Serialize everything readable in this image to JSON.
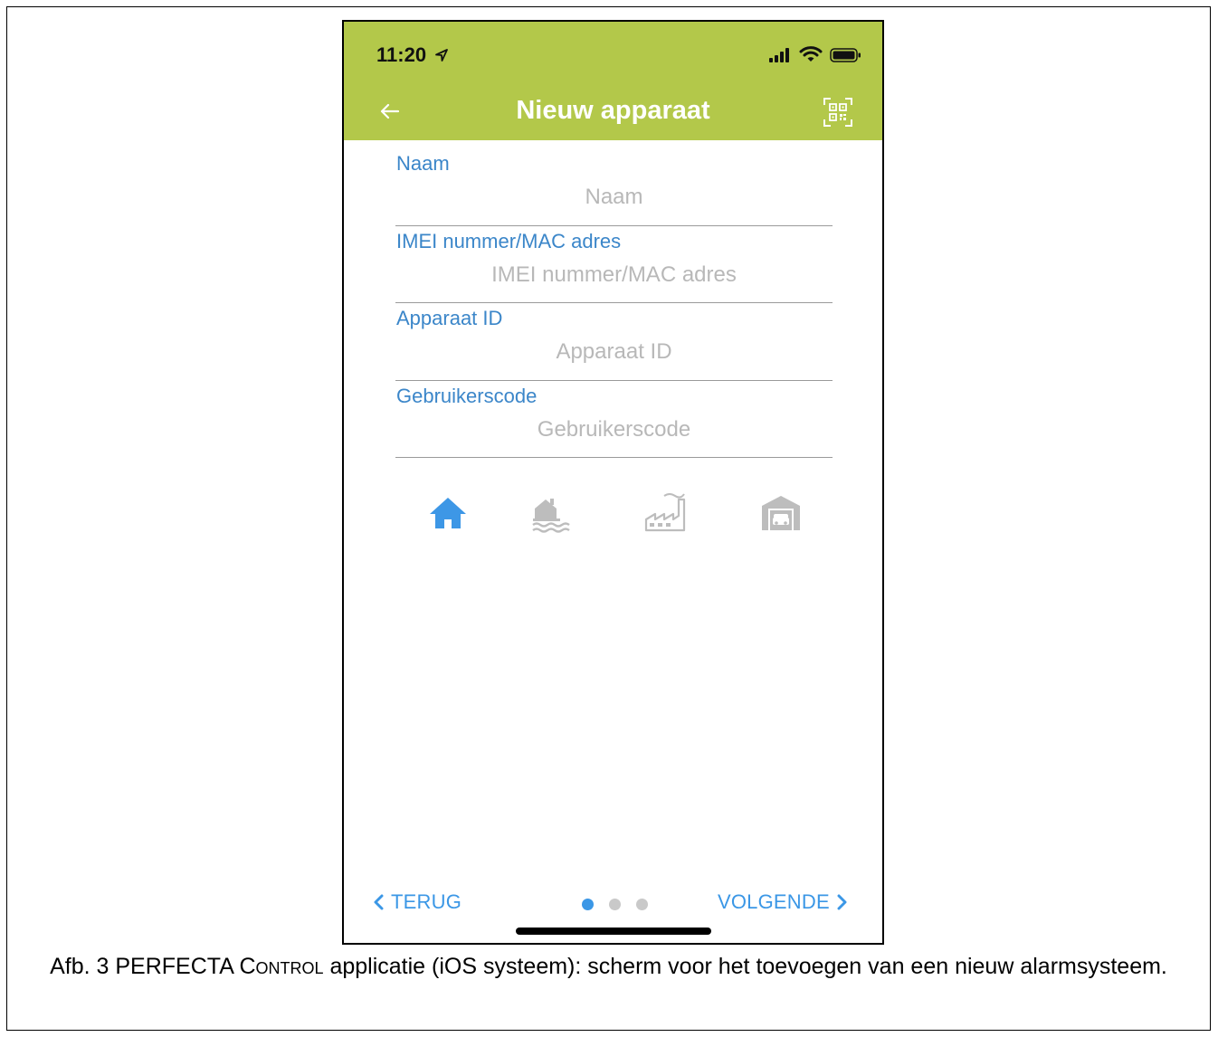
{
  "status_bar": {
    "time": "11:20"
  },
  "app_bar": {
    "title": "Nieuw apparaat"
  },
  "form": {
    "fields": [
      {
        "label": "Naam",
        "placeholder": "Naam",
        "value": ""
      },
      {
        "label": "IMEI nummer/MAC adres",
        "placeholder": "IMEI nummer/MAC adres",
        "value": ""
      },
      {
        "label": "Apparaat ID",
        "placeholder": "Apparaat ID",
        "value": ""
      },
      {
        "label": "Gebruikerscode",
        "placeholder": "Gebruikerscode",
        "value": ""
      }
    ]
  },
  "building_types": [
    {
      "icon": "house-icon",
      "selected": true
    },
    {
      "icon": "house-by-water-icon",
      "selected": false
    },
    {
      "icon": "factory-icon",
      "selected": false
    },
    {
      "icon": "garage-icon",
      "selected": false
    }
  ],
  "footer": {
    "back_label": "TERUG",
    "next_label": "VOLGENDE",
    "page_indicator": {
      "total": 3,
      "current": 1
    }
  },
  "caption": {
    "prefix": "Afb. 3 PERFECTA ",
    "app_name": "Control",
    "suffix": " applicatie (iOS systeem): scherm voor het toevoegen van een nieuw alarmsysteem."
  },
  "colors": {
    "accent_green": "#b3c84a",
    "label_blue": "#3b86c9",
    "selected_icon_blue": "#3d97e6",
    "unselected_icon_gray": "#bdbdbd",
    "placeholder_gray": "#b8b8b8"
  }
}
